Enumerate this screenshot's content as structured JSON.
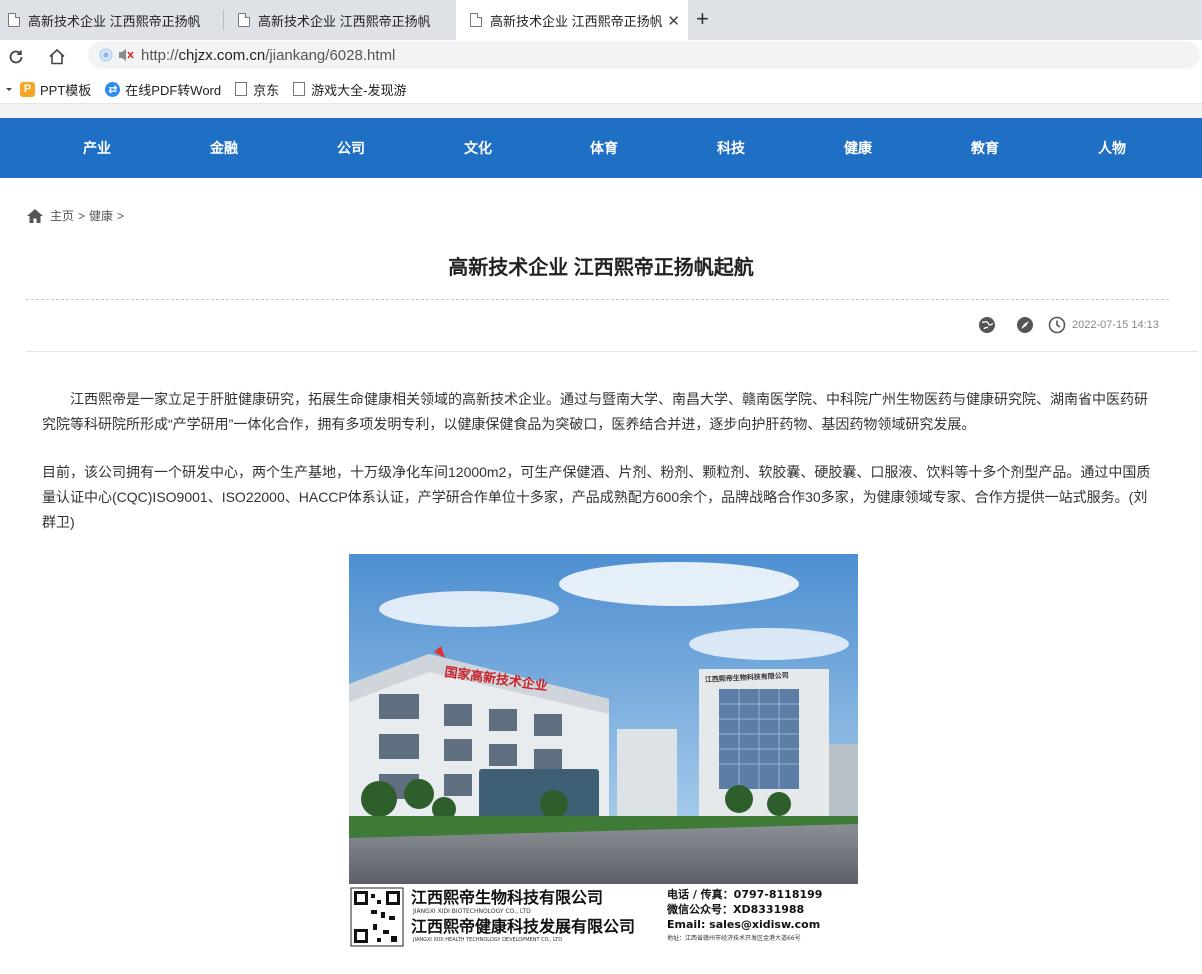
{
  "browser": {
    "tabs": [
      {
        "title": "高新技术企业 江西熙帝正扬帆起航"
      },
      {
        "title": "高新技术企业 江西熙帝正扬帆起航"
      },
      {
        "title": "高新技术企业 江西熙帝正扬帆起航"
      }
    ],
    "new_tab": "+",
    "close_tab": "✕",
    "url_scheme": "http://",
    "url_host": "chjzx.com.cn",
    "url_path": "/jiankang/6028.html",
    "bookmarks": [
      {
        "label": "PPT模板",
        "icon": "ppt-icon"
      },
      {
        "label": "在线PDF转Word",
        "icon": "pdf-convert-icon"
      },
      {
        "label": "京东",
        "icon": "page-icon"
      },
      {
        "label": "游戏大全-发现游",
        "icon": "page-icon"
      }
    ]
  },
  "site_nav": [
    "产业",
    "金融",
    "公司",
    "文化",
    "体育",
    "科技",
    "健康",
    "教育",
    "人物"
  ],
  "breadcrumb": {
    "home": "主页",
    "section": "健康",
    "sep": ">"
  },
  "article": {
    "title": "高新技术企业 江西熙帝正扬帆起航",
    "datetime": "2022-07-15 14:13",
    "paragraphs": [
      "江西熙帝是一家立足于肝脏健康研究，拓展生命健康相关领域的高新技术企业。通过与暨南大学、南昌大学、赣南医学院、中科院广州生物医药与健康研究院、湖南省中医药研究院等科研院所形成“产学研用”一体化合作，拥有多项发明专利，以健康保健食品为突破口，医养结合并进，逐步向护肝药物、基因药物领域研究发展。",
      "目前，该公司拥有一个研发中心，两个生产基地，十万级净化车间12000m2，可生产保健酒、片剂、粉剂、颗粒剂、软胶囊、硬胶囊、口服液、饮料等十多个剂型产品。通过中国质量认证中心(CQC)ISO9001、ISO22000、HACCP体系认证，产学研合作单位十多家，产品成熟配方600余个，品牌战略合作30多家，为健康领域专家、合作方提供一站式服务。(刘群卫)"
    ]
  },
  "photo": {
    "sign_left": "国家高新技术企业",
    "sign_right": "江西熙帝生物科技有限公司",
    "company_cn_1": "江西熙帝生物科技有限公司",
    "company_en_1": "JIANGXI XIDI BIOTECHNOLOGY CO., LTD",
    "company_cn_2": "江西熙帝健康科技发展有限公司",
    "company_en_2": "JIANGXI XIDI HEALTH TECHNOLOGY DEVELOPMENT CO., LTD",
    "phone": "电话 / 传真：0797-8118199",
    "wechat": "微信公众号：XD8331988",
    "email": "Email: sales@xidisw.com",
    "address": "地址：江西省赣州市经济技术开发区金港大道66号"
  },
  "colors": {
    "nav_bg": "#1f6fc5",
    "tabstrip_bg": "#dee1e6"
  }
}
